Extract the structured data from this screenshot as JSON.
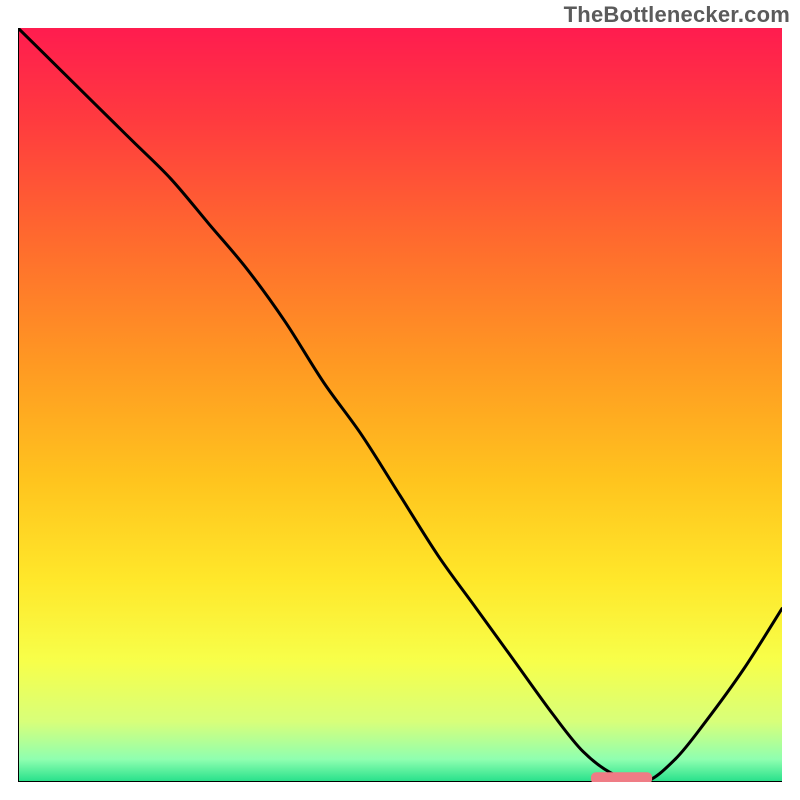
{
  "attribution": "TheBottlenecker.com",
  "chart_data": {
    "type": "line",
    "title": "",
    "xlabel": "",
    "ylabel": "",
    "xlim": [
      0,
      100
    ],
    "ylim": [
      0,
      100
    ],
    "x": [
      0,
      5,
      10,
      15,
      20,
      25,
      30,
      35,
      40,
      45,
      50,
      55,
      60,
      65,
      70,
      74,
      78,
      82,
      86,
      90,
      95,
      100
    ],
    "y": [
      100,
      95,
      90,
      85,
      80,
      74,
      68,
      61,
      53,
      46,
      38,
      30,
      23,
      16,
      9,
      4,
      1,
      0,
      3,
      8,
      15,
      23
    ],
    "marker": {
      "x_center": 79,
      "x_halfwidth": 4,
      "y": 0.5
    },
    "gradient_stops": [
      {
        "offset": 0.0,
        "color": "#ff1c4f"
      },
      {
        "offset": 0.12,
        "color": "#ff3a3f"
      },
      {
        "offset": 0.28,
        "color": "#ff6a2e"
      },
      {
        "offset": 0.45,
        "color": "#ff9a22"
      },
      {
        "offset": 0.6,
        "color": "#ffc41e"
      },
      {
        "offset": 0.73,
        "color": "#ffe72a"
      },
      {
        "offset": 0.84,
        "color": "#f7ff4a"
      },
      {
        "offset": 0.92,
        "color": "#d8ff7a"
      },
      {
        "offset": 0.97,
        "color": "#8fffb0"
      },
      {
        "offset": 1.0,
        "color": "#25e08a"
      }
    ],
    "curve_stroke": "#000000",
    "curve_width": 3,
    "marker_fill": "#ef7c85",
    "axis_stroke": "#000000",
    "axis_width": 2
  }
}
